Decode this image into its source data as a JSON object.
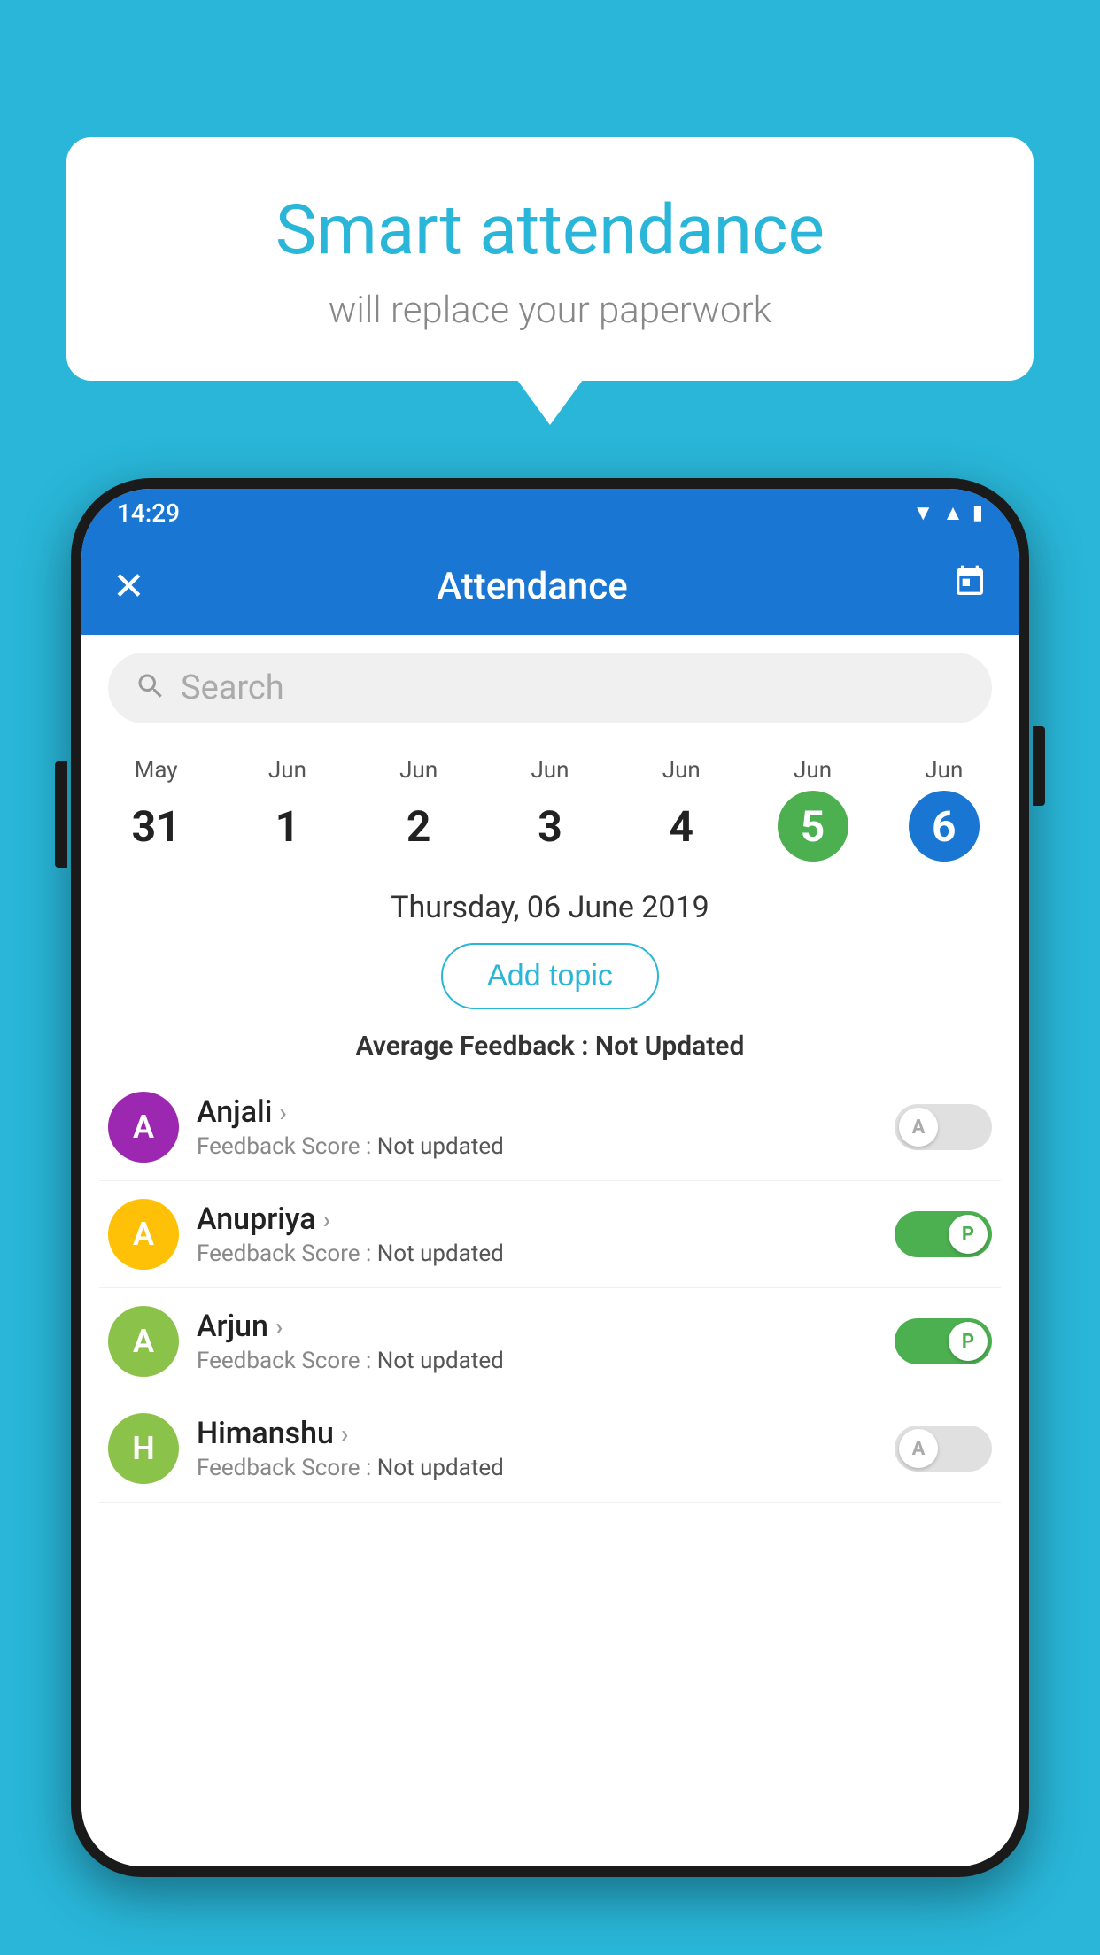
{
  "background_color": "#29b6d8",
  "speech_bubble": {
    "title": "Smart attendance",
    "subtitle": "will replace your paperwork"
  },
  "status_bar": {
    "time": "14:29"
  },
  "app_bar": {
    "title": "Attendance",
    "close_label": "✕",
    "calendar_label": "📅"
  },
  "search": {
    "placeholder": "Search"
  },
  "calendar": {
    "days": [
      {
        "month": "May",
        "date": "31",
        "state": "normal"
      },
      {
        "month": "Jun",
        "date": "1",
        "state": "normal"
      },
      {
        "month": "Jun",
        "date": "2",
        "state": "normal"
      },
      {
        "month": "Jun",
        "date": "3",
        "state": "normal"
      },
      {
        "month": "Jun",
        "date": "4",
        "state": "normal"
      },
      {
        "month": "Jun",
        "date": "5",
        "state": "today"
      },
      {
        "month": "Jun",
        "date": "6",
        "state": "selected"
      }
    ]
  },
  "selected_date": "Thursday, 06 June 2019",
  "add_topic_label": "Add topic",
  "average_feedback": {
    "label": "Average Feedback : ",
    "value": "Not Updated"
  },
  "students": [
    {
      "name": "Anjali",
      "avatar_letter": "A",
      "avatar_color": "#9c27b0",
      "feedback_label": "Feedback Score : ",
      "feedback_value": "Not updated",
      "toggle_state": "off",
      "toggle_label": "A"
    },
    {
      "name": "Anupriya",
      "avatar_letter": "A",
      "avatar_color": "#ffc107",
      "feedback_label": "Feedback Score : ",
      "feedback_value": "Not updated",
      "toggle_state": "on",
      "toggle_label": "P"
    },
    {
      "name": "Arjun",
      "avatar_letter": "A",
      "avatar_color": "#8bc34a",
      "feedback_label": "Feedback Score : ",
      "feedback_value": "Not updated",
      "toggle_state": "on",
      "toggle_label": "P"
    },
    {
      "name": "Himanshu",
      "avatar_letter": "H",
      "avatar_color": "#8bc34a",
      "feedback_label": "Feedback Score : ",
      "feedback_value": "Not updated",
      "toggle_state": "off",
      "toggle_label": "A"
    }
  ]
}
